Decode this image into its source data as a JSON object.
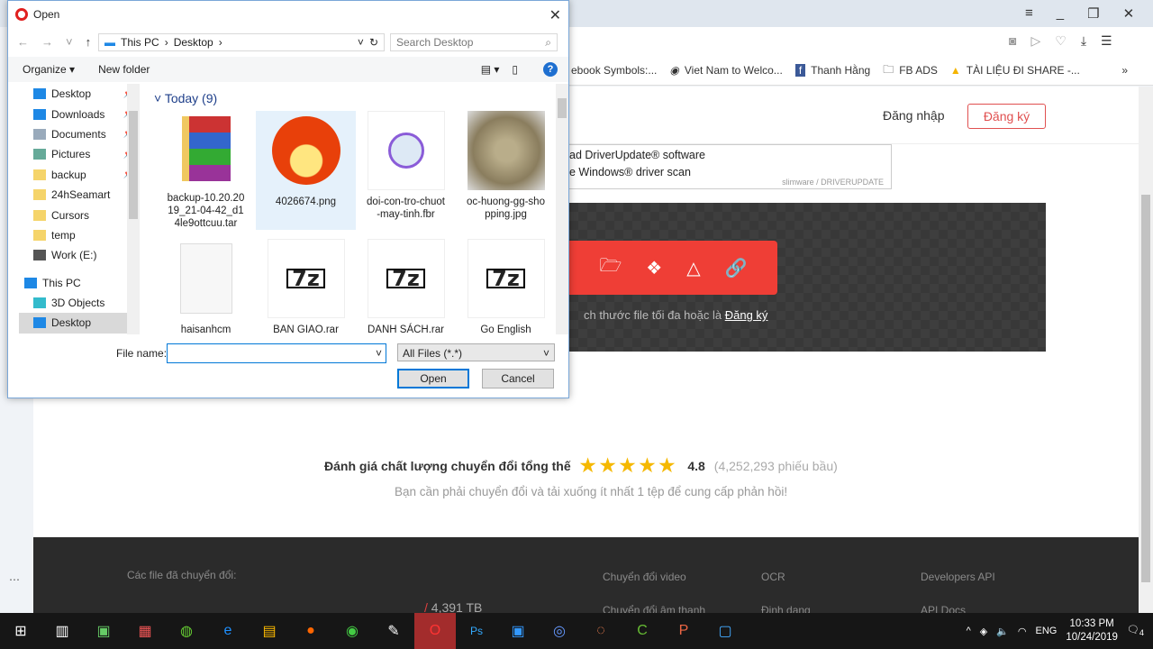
{
  "browser": {
    "bookmarks": [
      "ebook Symbols:...",
      "Viet Nam to Welco...",
      "Thanh Hằng",
      "FB ADS",
      "TÀI LIỆU ĐI SHARE -..."
    ],
    "more": "»"
  },
  "site": {
    "login": "Đăng nhập",
    "signup": "Đăng ký",
    "ad_line1": "ad DriverUpdate® software",
    "ad_line2": "e Windows® driver scan",
    "ad_brand": "slimware / DRIVERUPDATE",
    "upload_hint": "ch thước file tối đa hoặc là",
    "upload_link": "Đăng ký",
    "rating_label": "Đánh giá chất lượng chuyển đổi tổng thế",
    "stars": "★★★★★",
    "rating": "4.8",
    "votes": "(4,252,293 phiếu bầu)",
    "feedback": "Bạn cần phải chuyển đổi và tải xuống ít nhất 1 tệp để cung cấp phản hồi!",
    "footer": {
      "converted": "Các file đã chuyển đổi:",
      "total": "/ 4,391 TB",
      "links": [
        "Chuyển đổi video",
        "OCR",
        "Developers API",
        "Chuyển đổi âm thanh",
        "Định dạng",
        "API Docs"
      ]
    }
  },
  "dialog": {
    "title": "Open",
    "path": [
      "This PC",
      "Desktop"
    ],
    "search_placeholder": "Search Desktop",
    "organize": "Organize ▾",
    "new_folder": "New folder",
    "sidebar": [
      {
        "label": "Desktop",
        "pin": true
      },
      {
        "label": "Downloads",
        "pin": true
      },
      {
        "label": "Documents",
        "pin": true
      },
      {
        "label": "Pictures",
        "pin": true
      },
      {
        "label": "backup",
        "pin": true
      },
      {
        "label": "24hSeamart"
      },
      {
        "label": "Cursors"
      },
      {
        "label": "temp"
      },
      {
        "label": "Work (E:)"
      },
      {
        "label": "This PC"
      },
      {
        "label": "3D Objects"
      },
      {
        "label": "Desktop",
        "selected": true
      }
    ],
    "group": "Today (9)",
    "files": [
      "backup-10.20.2019_21-04-42_d14le9ottcuu.tar",
      "4026674.png",
      "doi-con-tro-chuot-may-tinh.fbr",
      "oc-huong-gg-shopping.jpg",
      "haisanhcm",
      "BAN GIAO.rar",
      "DANH SÁCH.rar",
      "Go English"
    ],
    "file_name_label": "File name:",
    "file_name_value": "",
    "file_type": "All Files (*.*)",
    "open": "Open",
    "cancel": "Cancel"
  },
  "taskbar": {
    "time": "10:33 PM",
    "date": "10/24/2019",
    "lang": "ENG",
    "notifications": "4"
  }
}
